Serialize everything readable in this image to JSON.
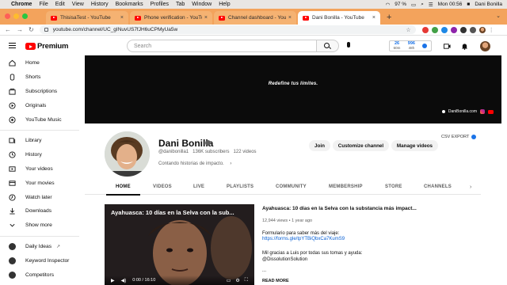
{
  "menubar": {
    "app": "Chrome",
    "items": [
      "File",
      "Edit",
      "View",
      "History",
      "Bookmarks",
      "Profiles",
      "Tab",
      "Window",
      "Help"
    ],
    "battery": "97 %",
    "clock": "Mon 00:56",
    "user": "Dani Bonilla"
  },
  "browser": {
    "tabs": [
      {
        "title": "ThisisaTest - YouTube"
      },
      {
        "title": "Phone verification - YouTube"
      },
      {
        "title": "Channel dashboard - YouTube"
      },
      {
        "title": "Dani Bonilla - YouTube",
        "active": true
      }
    ],
    "url": "youtube.com/channel/UC_gINuvUS7fJH6uCPMyUa5w"
  },
  "yt_header": {
    "logo_text": "Premium",
    "search_placeholder": "Search",
    "analytics": [
      {
        "value": "26",
        "label": "60m"
      },
      {
        "value": "996",
        "label": "48h"
      }
    ]
  },
  "sidebar": {
    "primary": [
      {
        "label": "Home",
        "icon": "home-icon"
      },
      {
        "label": "Shorts",
        "icon": "shorts-icon"
      },
      {
        "label": "Subscriptions",
        "icon": "subscriptions-icon"
      },
      {
        "label": "Originals",
        "icon": "originals-icon"
      },
      {
        "label": "YouTube Music",
        "icon": "music-icon"
      }
    ],
    "secondary": [
      {
        "label": "Library",
        "icon": "library-icon"
      },
      {
        "label": "History",
        "icon": "history-icon"
      },
      {
        "label": "Your videos",
        "icon": "your-videos-icon"
      },
      {
        "label": "Your movies",
        "icon": "movies-icon"
      },
      {
        "label": "Watch later",
        "icon": "watch-later-icon"
      },
      {
        "label": "Downloads",
        "icon": "download-icon"
      },
      {
        "label": "Show more",
        "icon": "chevron-down-icon"
      }
    ],
    "tools": [
      {
        "label": "Daily Ideas",
        "icon": "daily-ideas-icon"
      },
      {
        "label": "Keyword Inspector",
        "icon": "keyword-inspector-icon"
      },
      {
        "label": "Competitors",
        "icon": "competitors-icon"
      }
    ]
  },
  "banner": {
    "slogan": "Redefine tus límites.",
    "link": "DaniBonilla.com"
  },
  "channel": {
    "name": "Dani Bonilla",
    "handle": "@danibonilla1",
    "subscribers": "136K subscribers",
    "videos": "122 videos",
    "description": "Contando historias de impacto.",
    "buttons": {
      "join": "Join",
      "customize": "Customize channel",
      "manage": "Manage videos"
    },
    "csv_export": "CSV EXPORT"
  },
  "tabs": [
    "HOME",
    "VIDEOS",
    "LIVE",
    "PLAYLISTS",
    "COMMUNITY",
    "MEMBERSHIP",
    "STORE",
    "CHANNELS"
  ],
  "featured": {
    "thumb_title": "Ayahuasca: 10 días en la Selva con la sub...",
    "time": "0:00 / 16:10",
    "title": "Ayahuasca: 10 días en la Selva con la substancia más impact...",
    "views": "12,944 views",
    "age": "1 year ago",
    "desc_line1": "Formulario para saber más del viaje:",
    "desc_link1": "https://forms.gle/tpYTBiQbxCa7KumS9",
    "desc_line2": "Mil gracias a Luis por todas sus tomas y ayuda:",
    "desc_handle": "@DissolutionSolution",
    "desc_ellipsis": "...",
    "read_more": "READ MORE"
  },
  "colors": {
    "tabbar": "#f3a35c",
    "youtube_red": "#ff0000",
    "link_blue": "#065fd4"
  }
}
